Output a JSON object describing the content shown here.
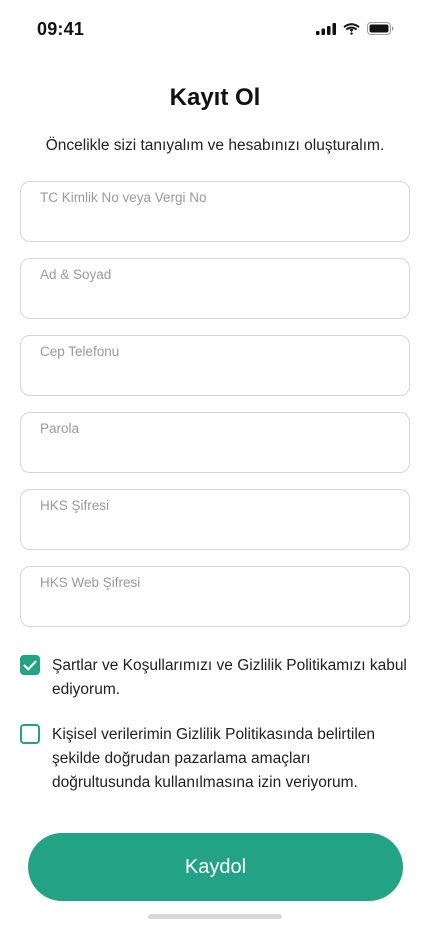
{
  "status_bar": {
    "time": "09:41"
  },
  "header": {
    "title": "Kayıt Ol",
    "subtitle": "Öncelikle sizi tanıyalım ve hesabınızı oluşturalım."
  },
  "form": {
    "fields": [
      {
        "label": "TC Kimlik No veya Vergi No",
        "value": ""
      },
      {
        "label": "Ad & Soyad",
        "value": ""
      },
      {
        "label": "Cep Telefonu",
        "value": ""
      },
      {
        "label": "Parola",
        "value": ""
      },
      {
        "label": "HKS Şifresi",
        "value": ""
      },
      {
        "label": "HKS Web Şifresi",
        "value": ""
      }
    ],
    "consents": [
      {
        "text": "Şartlar ve Koşullarımızı ve Gizlilik Politikamızı kabul ediyorum.",
        "checked": true
      },
      {
        "text": "Kişisel verilerimin Gizlilik Politikasında belirtilen şekilde doğrudan pazarlama amaçları doğrultusunda kullanılmasına izin veriyorum.",
        "checked": false
      }
    ],
    "submit_label": "Kaydol"
  },
  "colors": {
    "accent": "#23a386",
    "border": "#d6d6d6",
    "label": "#9a9a9a"
  },
  "icons": [
    "signal-icon",
    "wifi-icon",
    "battery-icon",
    "checkmark-icon"
  ]
}
